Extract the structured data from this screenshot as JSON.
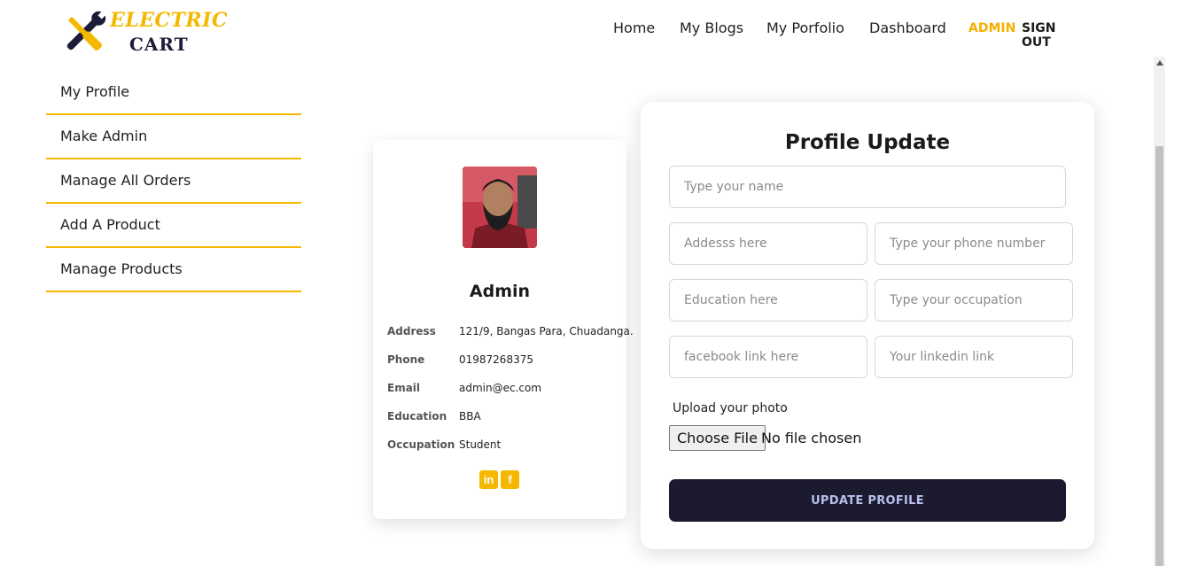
{
  "brand": {
    "line1": "ELECTRIC",
    "line2": "CART",
    "primary_color": "#f5b800",
    "dark_color": "#1c1c3a"
  },
  "nav": {
    "items": [
      "Home",
      "My Blogs",
      "My Porfolio",
      "Dashboard"
    ],
    "user_role": "ADMIN",
    "sign_out": "SIGN OUT"
  },
  "sidebar": {
    "items": [
      "My Profile",
      "Make Admin",
      "Manage All Orders",
      "Add A Product",
      "Manage Products"
    ]
  },
  "profile": {
    "name": "Admin",
    "fields": [
      {
        "label": "Address",
        "value": "121/9, Bangas Para, Chuadanga."
      },
      {
        "label": "Phone",
        "value": "01987268375"
      },
      {
        "label": "Email",
        "value": "admin@ec.com"
      },
      {
        "label": "Education",
        "value": "BBA"
      },
      {
        "label": "Occupation",
        "value": "Student"
      }
    ],
    "social_icons": [
      "linkedin-icon",
      "facebook-icon"
    ]
  },
  "form": {
    "title": "Profile Update",
    "placeholders": {
      "name": "Type your name",
      "address": "Addesss here",
      "phone": "Type your phone number",
      "education": "Education here",
      "occupation": "Type your occupation",
      "facebook": "facebook link here",
      "linkedin": "Your linkedin link"
    },
    "upload_label": "Upload your photo",
    "file_button": "Choose File",
    "file_status": "No file chosen",
    "submit": "UPDATE PROFILE"
  }
}
